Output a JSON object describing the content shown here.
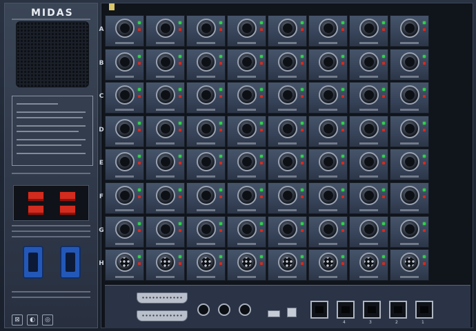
{
  "brand": {
    "logo_text": "MIDAS"
  },
  "rack": {
    "row_letters": [
      "A",
      "B",
      "C",
      "D",
      "E",
      "F",
      "G",
      "H"
    ],
    "cards_per_row": 8,
    "row_kinds": [
      "input",
      "input",
      "input",
      "input",
      "input",
      "input",
      "input",
      "output"
    ]
  },
  "rear_panel": {
    "bottom_port_numbers": [
      "4",
      "3",
      "2",
      "1"
    ]
  },
  "colors": {
    "led_green": "#2fd24a",
    "led_red": "#d82a1c",
    "power_switch": "#d42b1f",
    "iec_inlet": "#2358b8"
  }
}
